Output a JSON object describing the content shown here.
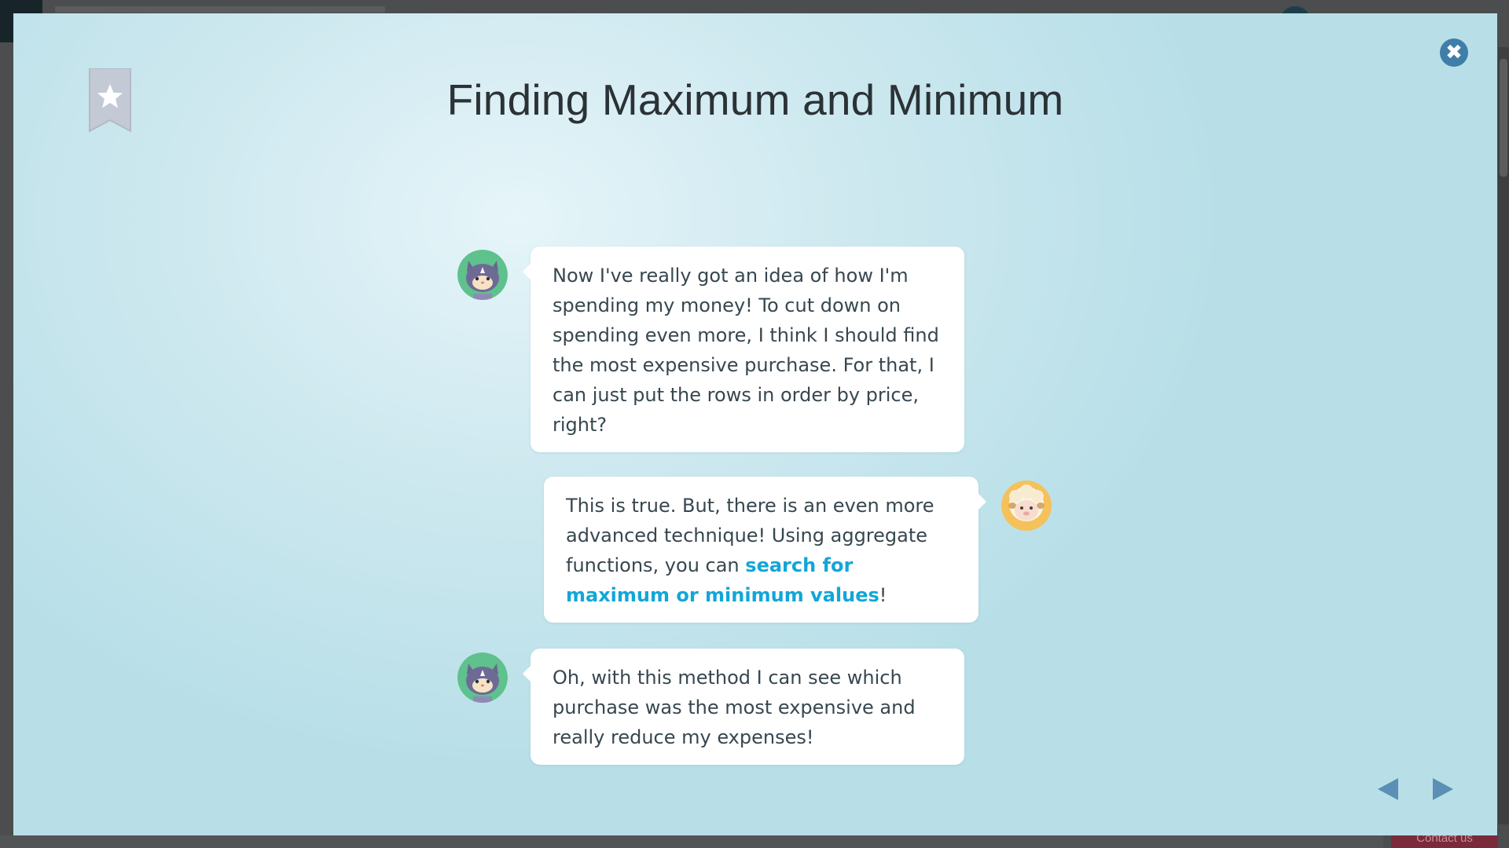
{
  "lesson": {
    "title": "Finding Maximum and Minimum"
  },
  "icons": {
    "close": "close-icon",
    "bookmark": "star-bookmark-icon",
    "prev": "arrow-left-icon",
    "next": "arrow-right-icon"
  },
  "colors": {
    "highlight": "#12a6d8",
    "close_button": "#3f7ea8",
    "nav_arrows": "#5b8fb5",
    "bookmark": "#c3cad6"
  },
  "dialogue": [
    {
      "speaker": "cat",
      "side": "left",
      "text": "Now I've really got an idea of how I'm spending my money! To cut down on spending even more, I think I should find the most expensive purchase. For that, I can just put the rows in order by price, right?"
    },
    {
      "speaker": "sheep",
      "side": "right",
      "text_before": "This is true. But, there is an even more advanced technique! Using aggregate functions, you can ",
      "highlight": "search for maximum or minimum values",
      "text_after": "!"
    },
    {
      "speaker": "cat",
      "side": "left",
      "text": "Oh, with this method I can see which purchase was the most expensive and really reduce my expenses!"
    }
  ],
  "background": {
    "contact_label": "Contact us"
  }
}
